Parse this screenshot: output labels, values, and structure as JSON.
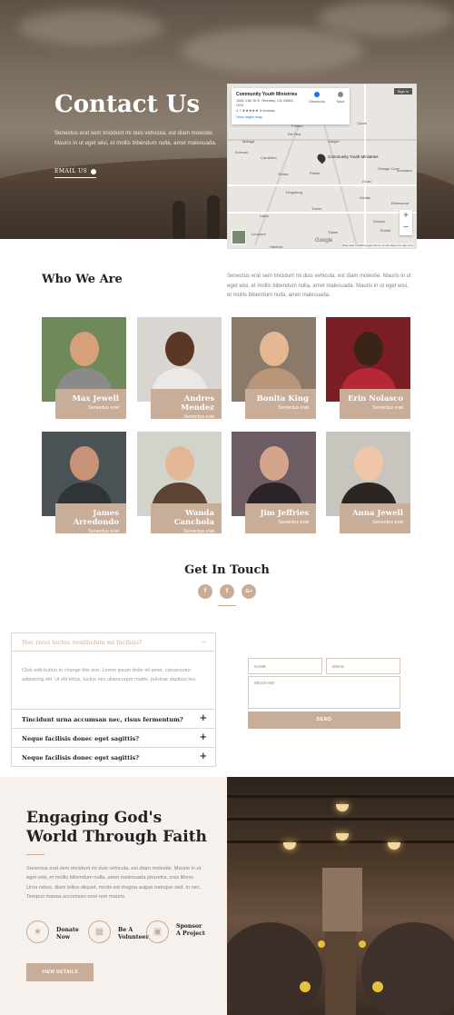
{
  "hero": {
    "title": "Contact Us",
    "text": "Senectus erat sem tincidunt mi duis vehicula, est diam molestie. Mauris in ut eget wisi, et mollis bibendum nulla, amet malesuada.",
    "link_label": "EMAIL US"
  },
  "map": {
    "place_name": "Community Youth Ministries",
    "address": "1582 11th St E, Reedley, CA 93654, USA",
    "rating": "4.7 ★★★★★",
    "reviews": "3 reviews",
    "larger_map": "View larger map",
    "directions": "Directions",
    "save": "Save",
    "sign_in": "Sign in",
    "pin_label": "Community Youth Ministries",
    "towns": [
      "Clovis",
      "Fresno",
      "Malaga",
      "Kerman",
      "Caruthers",
      "Riverdale",
      "Selma",
      "Parlier",
      "Kingsburg",
      "Laton",
      "Hanford",
      "Dinuba",
      "Visalia",
      "Exeter",
      "Orosi",
      "Woodlake",
      "Sanger",
      "Reedley",
      "Orange Cove",
      "Elderwood",
      "Auckland",
      "Traver",
      "Tulare",
      "Lemoore",
      "Squaw Valley",
      "Sultana",
      "Yettem",
      "Del Rey",
      "Farmersville"
    ],
    "google": "Google",
    "footer": "Map data ©2018 Google   Terms of Use   Report a map error",
    "zoom_in": "+",
    "zoom_out": "−"
  },
  "who": {
    "title": "Who We Are",
    "text": "Senectus erat sem tincidunt mi duis vehicula, est diam molestie. Mauris in ut eget wisi, et mollis bibendum nulla, amet malesuada. Mauris in ut eget wisi, et mollis bibendum nulla, amet malesuada."
  },
  "team": [
    {
      "name": "Max Jewell",
      "role": "Senectus erat",
      "bg": "#6f8a5a",
      "skin": "#d7a07a",
      "shirt": "#8a8a8a"
    },
    {
      "name": "Andres Mendez",
      "role": "Senectus erat",
      "bg": "#d9d6d1",
      "skin": "#5a3826",
      "shirt": "#ebe9e5"
    },
    {
      "name": "Bonita King",
      "role": "Senectus erat",
      "bg": "#8b7a6a",
      "skin": "#e5b792",
      "shirt": "#b8967a"
    },
    {
      "name": "Erin Nolasco",
      "role": "Senectus erat",
      "bg": "#7a1d24",
      "skin": "#3a2418",
      "shirt": "#b82735"
    },
    {
      "name": "James Arredondo",
      "role": "Senectus erat",
      "bg": "#4a5256",
      "skin": "#c79276",
      "shirt": "#2f3437"
    },
    {
      "name": "Wanda Canchola",
      "role": "Senectus erat",
      "bg": "#d2d4cc",
      "skin": "#e4b797",
      "shirt": "#5c4333"
    },
    {
      "name": "Jim Jeffries",
      "role": "Senectus erat",
      "bg": "#6d5c63",
      "skin": "#d4a58a",
      "shirt": "#2c2328"
    },
    {
      "name": "Anna Jewell",
      "role": "Senectus erat",
      "bg": "#c8c5bf",
      "skin": "#f0c6a8",
      "shirt": "#2b2622"
    }
  ],
  "touch": {
    "title": "Get In Touch",
    "social": [
      {
        "icon": "facebook-icon",
        "glyph": "f"
      },
      {
        "icon": "twitter-icon",
        "glyph": "t"
      },
      {
        "icon": "google-plus-icon",
        "glyph": "G+"
      }
    ]
  },
  "accordion": {
    "open_title": "Nec risus luctus vestibulum mi facilisis?",
    "open_body": "Click edit button to change this text. Lorem ipsum dolor sit amet, consectetur adipiscing elit. Ut elit tellus, luctus nec ullamcorper mattis, pulvinar dapibus leo.",
    "items": [
      "Tincidunt urna accumsan nec, risus fermentum?",
      "Neque facilisis donec eget sagittis?",
      "Neque facilisis donec eget sagittis?"
    ]
  },
  "form": {
    "name_placeholder": "NAME",
    "email_placeholder": "EMAIL",
    "message_placeholder": "MESSAGE",
    "send_label": "SEND"
  },
  "faith": {
    "title": "Engaging God's World Through Faith",
    "text": "Senectus erat sem tincidunt mi duis vehicula, est diam molestie. Mauris in ut eget wisi, et mollis bibendum nulla, amet malesuada pharetra, cras libero. Urna netus, diam tellus aliquet, morbi est magna augue natoque sed, in nec. Tempus massa accumsan eros non mauris.",
    "actions": [
      {
        "label": "Donate Now",
        "icon": "star-icon",
        "glyph": "★"
      },
      {
        "label": "Be A Volunteer",
        "icon": "grid-icon",
        "glyph": "▦"
      },
      {
        "label": "Sponsor A Project",
        "icon": "money-icon",
        "glyph": "▣"
      }
    ],
    "button_label": "VIEW DETAILS"
  },
  "colors": {
    "accent": "#c8ad99",
    "text_dark": "#222222",
    "text_muted": "#8a8179"
  }
}
